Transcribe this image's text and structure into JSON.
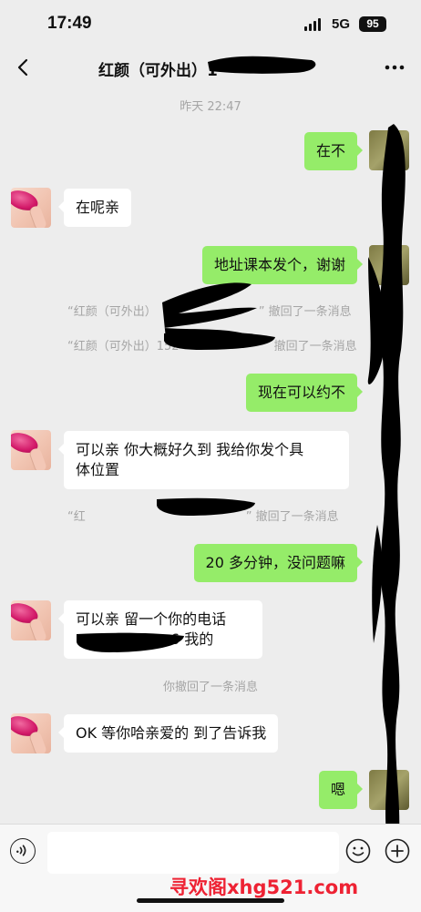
{
  "status_bar": {
    "time": "17:49",
    "carrier": "5G",
    "battery": "95"
  },
  "header": {
    "title": "红颜（可外出）1"
  },
  "chat": {
    "timestamp": "昨天 22:47",
    "messages": [
      {
        "side": "out",
        "text": "在不"
      },
      {
        "side": "in",
        "text": "在呢亲"
      },
      {
        "side": "out",
        "text": "地址课本发个，谢谢"
      },
      {
        "side": "system",
        "prefix": "“红颜（可外出）",
        "suffix": "” 撤回了一条消息"
      },
      {
        "side": "system",
        "prefix": "“红颜（可外出）152",
        "suffix": "撤回了一条消息"
      },
      {
        "side": "out",
        "text": "现在可以约不"
      },
      {
        "side": "in",
        "line1": "可以亲 你大概好久到  我给你发个具",
        "line2": "体位置"
      },
      {
        "side": "system",
        "prefix": "“红",
        "suffix": "” 撤回了一条消息"
      },
      {
        "side": "out",
        "text": "20 多分钟，没问题嘛"
      },
      {
        "side": "in",
        "line1": "可以亲 留一个你的电话",
        "line2": "6 我的"
      },
      {
        "side": "system",
        "text": "你撤回了一条消息"
      },
      {
        "side": "in",
        "text": "OK  等你哈亲爱的  到了告诉我"
      },
      {
        "side": "out",
        "text": "嗯"
      }
    ]
  },
  "input_bar": {
    "value": "",
    "placeholder": ""
  },
  "watermark": "寻欢阁xhg521.com",
  "colors": {
    "background": "#ededed",
    "outgoing_bubble": "#95ec69",
    "incoming_bubble": "#ffffff",
    "system_text": "#a5a5a5",
    "watermark": "#ee2233"
  },
  "icons": {
    "back": "chevron-left-icon",
    "more": "more-dots-icon",
    "voice": "voice-icon",
    "emoji": "emoji-icon",
    "plus": "plus-icon"
  }
}
